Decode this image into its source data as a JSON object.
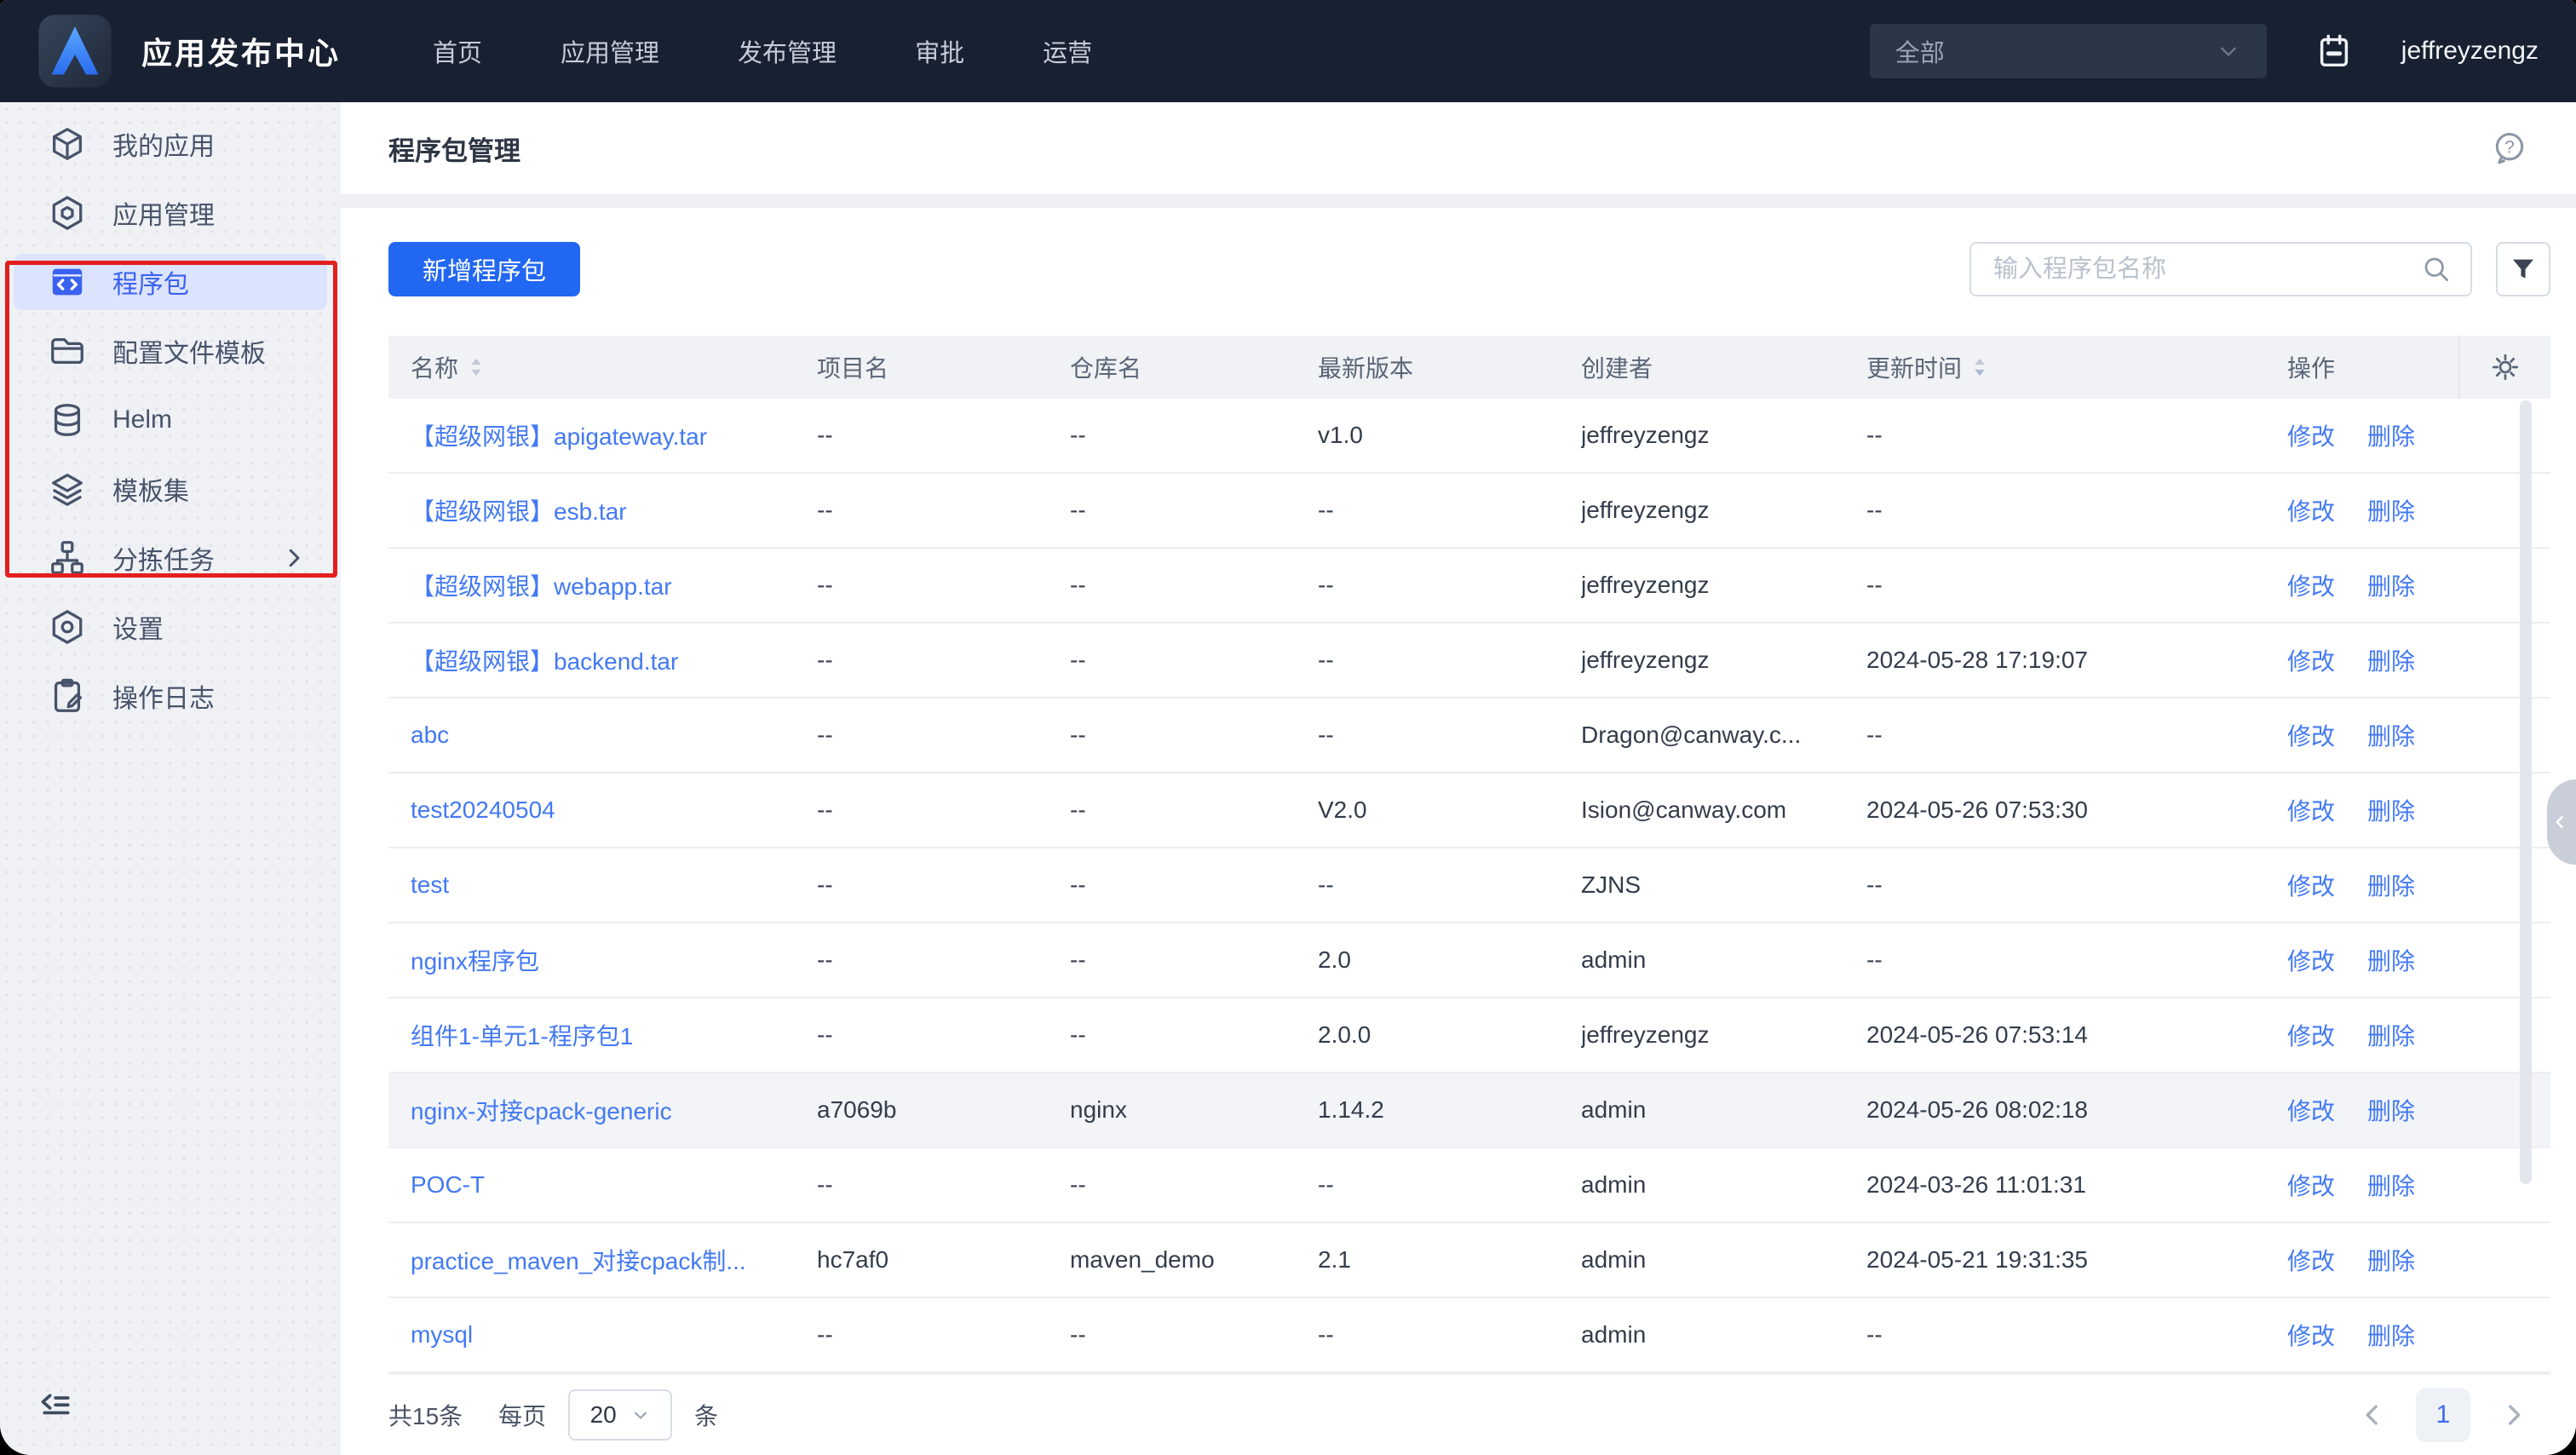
{
  "colors": {
    "accent_blue": "#2267f2",
    "link_blue": "#4379f4",
    "active_item_blue": "#3a62f0",
    "navbar_bg": "#182132",
    "annotation_red": "#e41e1e"
  },
  "navbar": {
    "brand": "应用发布中心",
    "items": [
      {
        "label": "首页"
      },
      {
        "label": "应用管理"
      },
      {
        "label": "发布管理"
      },
      {
        "label": "审批"
      },
      {
        "label": "运营"
      }
    ],
    "scope_select_value": "全部",
    "username": "jeffreyzengz"
  },
  "sidebar": {
    "items": [
      {
        "label": "我的应用"
      },
      {
        "label": "应用管理"
      },
      {
        "label": "程序包"
      },
      {
        "label": "配置文件模板"
      },
      {
        "label": "Helm"
      },
      {
        "label": "模板集"
      },
      {
        "label": "分拣任务"
      },
      {
        "label": "设置"
      },
      {
        "label": "操作日志"
      }
    ]
  },
  "page": {
    "title": "程序包管理"
  },
  "toolbar": {
    "add_button": "新增程序包",
    "search_placeholder": "输入程序包名称"
  },
  "table": {
    "columns": [
      "名称",
      "项目名",
      "仓库名",
      "最新版本",
      "创建者",
      "更新时间",
      "操作"
    ],
    "ops": {
      "edit": "修改",
      "delete": "删除"
    },
    "rows": [
      {
        "name": "【超级网银】apigateway.tar",
        "project": "--",
        "repo": "--",
        "version": "v1.0",
        "creator": "jeffreyzengz",
        "updated": "--"
      },
      {
        "name": "【超级网银】esb.tar",
        "project": "--",
        "repo": "--",
        "version": "--",
        "creator": "jeffreyzengz",
        "updated": "--"
      },
      {
        "name": "【超级网银】webapp.tar",
        "project": "--",
        "repo": "--",
        "version": "--",
        "creator": "jeffreyzengz",
        "updated": "--"
      },
      {
        "name": "【超级网银】backend.tar",
        "project": "--",
        "repo": "--",
        "version": "--",
        "creator": "jeffreyzengz",
        "updated": "2024-05-28 17:19:07"
      },
      {
        "name": "abc",
        "project": "--",
        "repo": "--",
        "version": "--",
        "creator": "Dragon@canway.c...",
        "updated": "--"
      },
      {
        "name": "test20240504",
        "project": "--",
        "repo": "--",
        "version": "V2.0",
        "creator": "Ision@canway.com",
        "updated": "2024-05-26 07:53:30"
      },
      {
        "name": "test",
        "project": "--",
        "repo": "--",
        "version": "--",
        "creator": "ZJNS",
        "updated": "--"
      },
      {
        "name": "nginx程序包",
        "project": "--",
        "repo": "--",
        "version": "2.0",
        "creator": "admin",
        "updated": "--"
      },
      {
        "name": "组件1-单元1-程序包1",
        "project": "--",
        "repo": "--",
        "version": "2.0.0",
        "creator": "jeffreyzengz",
        "updated": "2024-05-26 07:53:14"
      },
      {
        "name": "nginx-对接cpack-generic",
        "project": "a7069b",
        "repo": "nginx",
        "version": "1.14.2",
        "creator": "admin",
        "updated": "2024-05-26 08:02:18"
      },
      {
        "name": "POC-T",
        "project": "--",
        "repo": "--",
        "version": "--",
        "creator": "admin",
        "updated": "2024-03-26 11:01:31"
      },
      {
        "name": "practice_maven_对接cpack制...",
        "project": "hc7af0",
        "repo": "maven_demo",
        "version": "2.1",
        "creator": "admin",
        "updated": "2024-05-21 19:31:35"
      },
      {
        "name": "mysql",
        "project": "--",
        "repo": "--",
        "version": "--",
        "creator": "admin",
        "updated": "--"
      }
    ]
  },
  "pagination": {
    "total": "共15条",
    "per_page_label": "每页",
    "page_size": "20",
    "unit_label": "条",
    "current_page": "1"
  }
}
